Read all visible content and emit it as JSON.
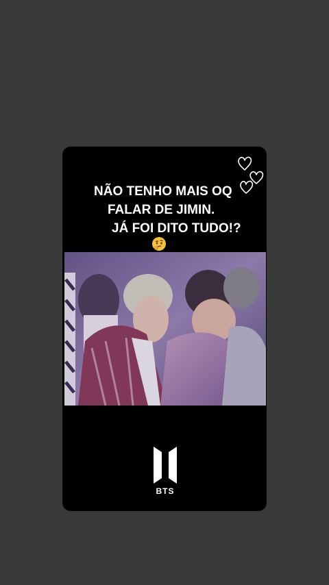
{
  "story": {
    "caption_lines": [
      "NÃO TENHO MAIS OQ",
      "FALAR DE JIMIN.",
      "JÁ FOI DITO TUDO!?"
    ],
    "emoji": "thinking-face-emoji",
    "decoration": "hearts-icon",
    "media": "video-frame"
  },
  "brand": {
    "logo": "bts-logo-icon",
    "name": "BTS"
  },
  "colors": {
    "background": "#3a3a3b",
    "card": "#000000",
    "text": "#ffffff",
    "emoji": "#f5c23a"
  }
}
